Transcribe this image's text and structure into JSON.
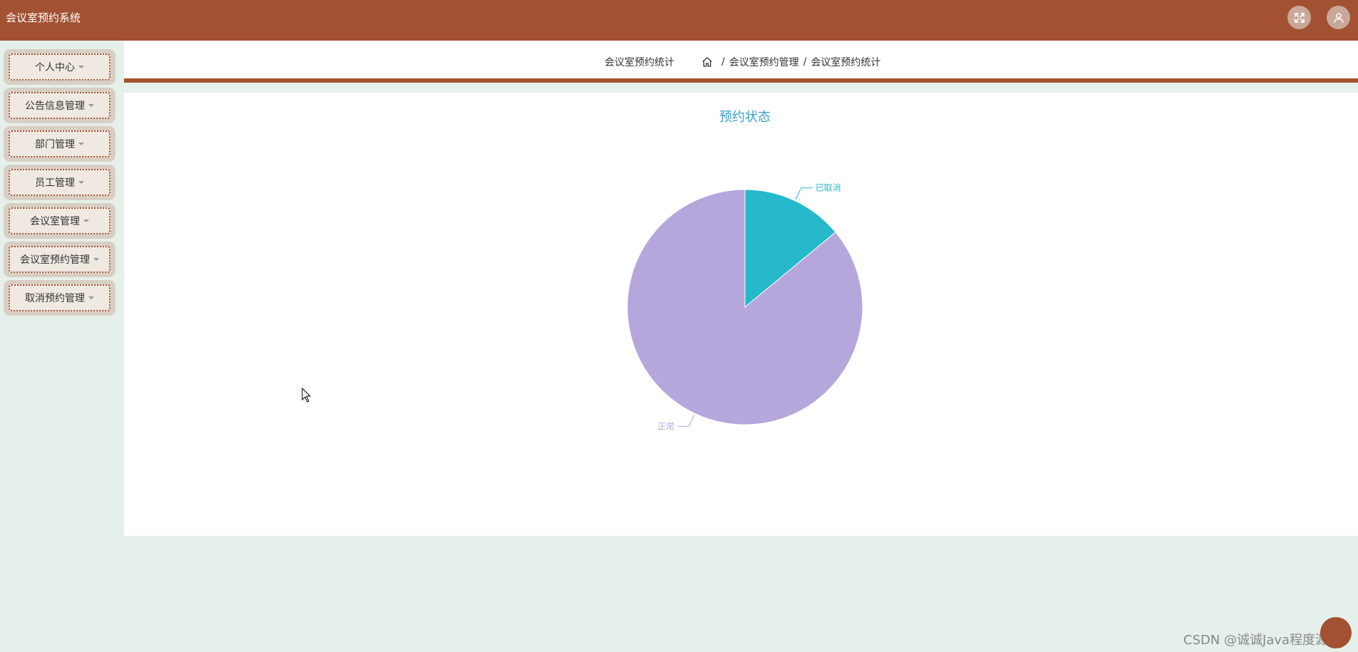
{
  "app": {
    "title": "会议室预约系统"
  },
  "topbar": {
    "icons": [
      "fullscreen-icon",
      "user-icon"
    ],
    "icon_bg": "#c9a89a",
    "bg_color": "#a25132"
  },
  "sidebar": {
    "items": [
      {
        "label": "个人中心"
      },
      {
        "label": "公告信息管理"
      },
      {
        "label": "部门管理"
      },
      {
        "label": "员工管理"
      },
      {
        "label": "会议室管理"
      },
      {
        "label": "会议室预约管理"
      },
      {
        "label": "取消预约管理"
      }
    ]
  },
  "header": {
    "page_label": "会议室预约统计",
    "breadcrumb": [
      "会议室预约管理",
      "会议室预约统计"
    ],
    "breadcrumb_sep": "/"
  },
  "chart_data": {
    "type": "pie",
    "title": "预约状态",
    "slices": [
      {
        "name": "已取消",
        "value": 14,
        "color": "#26b8cb"
      },
      {
        "name": "正常",
        "value": 86,
        "color": "#b5a6dc"
      }
    ],
    "title_color": "#3aa3c8"
  },
  "watermark": "CSDN @诚诚Java程度源码"
}
